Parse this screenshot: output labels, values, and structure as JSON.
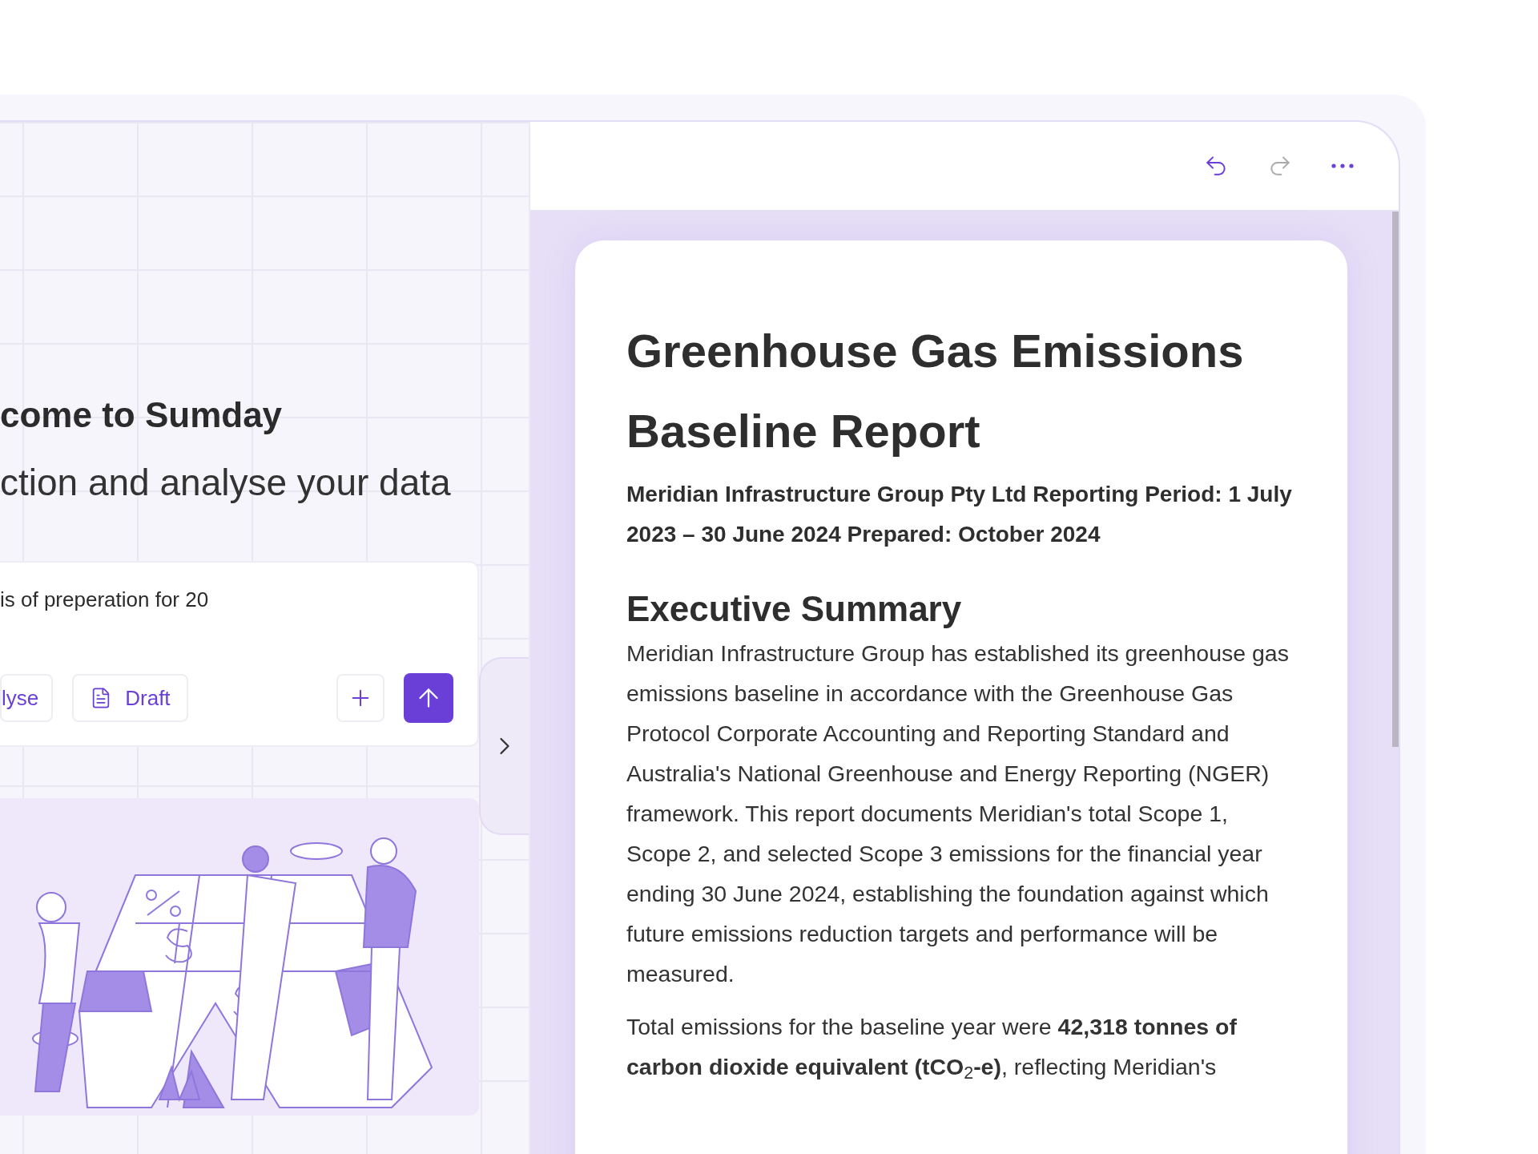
{
  "welcome": {
    "heading": "come to Sumday",
    "subheading": "ction and analyse your data"
  },
  "prompt": {
    "value": "is of preperation for 20"
  },
  "modes": [
    {
      "label": "lyse",
      "kind": "text"
    },
    {
      "label": "Draft",
      "kind": "document"
    }
  ],
  "toolbar": {
    "undo": {
      "disabled": false
    },
    "redo": {
      "disabled": true
    }
  },
  "document": {
    "title": "Greenhouse Gas Emissions Baseline Report",
    "meta": "Meridian Infrastructure Group Pty Ltd Reporting Period: 1 July 2023 – 30 June 2024 Prepared: October 2024",
    "sections": [
      {
        "heading": "Executive Summary",
        "paragraphs": [
          "Meridian Infrastructure Group has established its greenhouse gas emissions baseline in accordance with the Greenhouse Gas Protocol Corporate Accounting and Reporting Standard and Australia's National Greenhouse and Energy Reporting (NGER) framework. This report documents Meridian's total Scope 1, Scope 2, and selected Scope 3 emissions for the financial year ending 30 June 2024, establishing the foundation against which future emissions reduction targets and performance will be measured.",
          "Total emissions for the baseline year were **42,318 tonnes of carbon dioxide equivalent (tCO**$_{2}$**-e)**, reflecting Meridian's"
        ]
      }
    ]
  }
}
